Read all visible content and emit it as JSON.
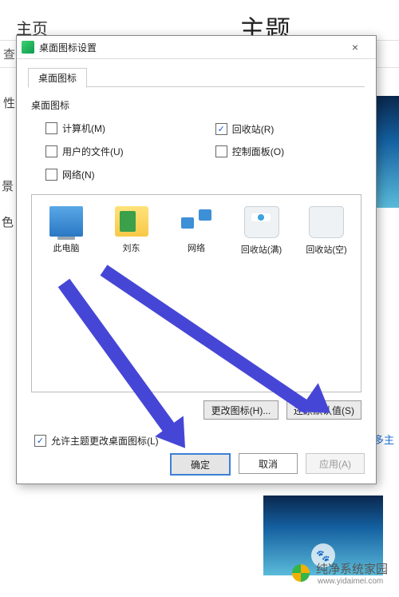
{
  "background": {
    "breadcrumb": "主页",
    "page_title": "主题",
    "search_stub": "查扎",
    "sidelabel_1": "性化",
    "sidelabel_2": "景",
    "sidelabel_3": "色",
    "more_themes": "多主"
  },
  "dialog": {
    "title": "桌面图标设置",
    "close_glyph": "×",
    "tab_label": "桌面图标",
    "section_label": "桌面图标",
    "checkboxes": {
      "computer": {
        "label": "计算机(M)",
        "checked": false
      },
      "recycle": {
        "label": "回收站(R)",
        "checked": true
      },
      "userfiles": {
        "label": "用户的文件(U)",
        "checked": false
      },
      "cpanel": {
        "label": "控制面板(O)",
        "checked": false
      },
      "network": {
        "label": "网络(N)",
        "checked": false
      }
    },
    "icons": [
      {
        "key": "pc",
        "label": "此电脑"
      },
      {
        "key": "user",
        "label": "刘东"
      },
      {
        "key": "net",
        "label": "网络"
      },
      {
        "key": "binf",
        "label": "回收站(满)"
      },
      {
        "key": "bine",
        "label": "回收站(空)"
      }
    ],
    "change_icon_btn": "更改图标(H)...",
    "restore_btn": "还原默认值(S)",
    "allow_theme": {
      "label": "允许主题更改桌面图标(L)",
      "checked": true
    },
    "buttons": {
      "ok": "确定",
      "cancel": "取消",
      "apply": "应用(A)"
    }
  },
  "annotation": {
    "color": "#4646d6"
  },
  "watermark": {
    "brand": "纯净系统家园",
    "url": "www.yidaimei.com"
  }
}
